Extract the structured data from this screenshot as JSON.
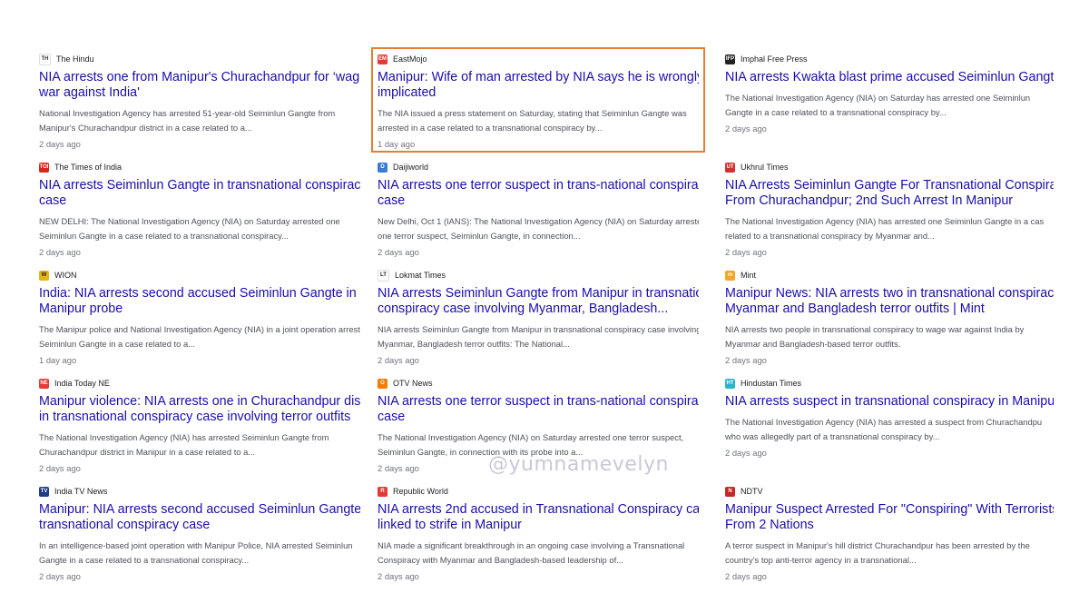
{
  "watermark": "@yumnamevelyn",
  "columns": [
    [
      {
        "source": "The Hindu",
        "favicon_text": "TH",
        "favicon_color": "#ffffff",
        "favicon_fg": "#333333",
        "title": [
          "NIA arrests one from Manipur's Churachandpur for ‘waging",
          "war against India'"
        ],
        "snippet": [
          "National Investigation Agency has arrested 51-year-old Seiminlun Gangte from",
          "Manipur's Churachandpur district in a case related to a..."
        ],
        "age": "2 days ago"
      },
      {
        "source": "The Times of India",
        "favicon_text": "TOI",
        "favicon_color": "#d7261e",
        "favicon_fg": "#ffffff",
        "title": [
          "NIA arrests Seiminlun Gangte in transnational conspiracy",
          "case"
        ],
        "snippet": [
          "NEW DELHI: The National Investigation Agency (NIA) on Saturday arrested one",
          "Seiminlun Gangte in a case related to a transnational conspiracy..."
        ],
        "age": "2 days ago"
      },
      {
        "source": "WION",
        "favicon_text": "W",
        "favicon_color": "#e7b416",
        "favicon_fg": "#222222",
        "title": [
          "India: NIA arrests second accused Seiminlun Gangte in",
          "Manipur probe"
        ],
        "snippet": [
          "The Manipur police and National Investigation Agency (NIA) in a joint operation arreste",
          "Seiminlun Gangte in a case related to a..."
        ],
        "age": "1 day ago"
      },
      {
        "source": "India Today NE",
        "favicon_text": "NE",
        "favicon_color": "#e53935",
        "favicon_fg": "#ffffff",
        "title": [
          "Manipur violence: NIA arrests one in Churachandpur district",
          "in transnational conspiracy case involving terror outfits"
        ],
        "snippet": [
          "The National Investigation Agency (NIA) has arrested Seiminlun Gangte from",
          "Churachandpur district in Manipur in a case related to a..."
        ],
        "age": "2 days ago"
      },
      {
        "source": "India TV News",
        "favicon_text": "TV",
        "favicon_color": "#1f3c88",
        "favicon_fg": "#ffffff",
        "title": [
          "Manipur: NIA arrests second accused Seiminlun Gangte in",
          "transnational conspiracy case"
        ],
        "snippet": [
          "In an intelligence-based joint operation with Manipur Police, NIA arrested Seiminlun",
          "Gangte in a case related to a transnational conspiracy..."
        ],
        "age": "2 days ago"
      }
    ],
    [
      {
        "source": "EastMojo",
        "favicon_text": "EM",
        "favicon_color": "#e53935",
        "favicon_fg": "#ffffff",
        "highlight": true,
        "title": [
          "Manipur: Wife of man arrested by NIA says he is wrongly",
          "implicated"
        ],
        "snippet": [
          "The NIA issued a press statement on Saturday, stating that Seiminlun Gangte was",
          "arrested in a case related to a transnational conspiracy by..."
        ],
        "age": "1 day ago"
      },
      {
        "source": "Daijiworld",
        "favicon_text": "D",
        "favicon_color": "#3a7bd5",
        "favicon_fg": "#ffffff",
        "title": [
          "NIA arrests one terror suspect in trans-national conspiracy",
          "case"
        ],
        "snippet": [
          "New Delhi, Oct 1 (IANS): The National Investigation Agency (NIA) on Saturday arrested",
          "one terror suspect, Seiminlun Gangte, in connection..."
        ],
        "age": "2 days ago"
      },
      {
        "source": "Lokmat Times",
        "favicon_text": "LT",
        "favicon_color": "#ffffff",
        "favicon_fg": "#222222",
        "title": [
          "NIA arrests Seiminlun Gangte from Manipur in transnational",
          "conspiracy case involving Myanmar, Bangladesh..."
        ],
        "snippet": [
          "NIA arrests Seiminlun Gangte from Manipur in transnational conspiracy case involving",
          "Myanmar, Bangladesh terror outfits: The National..."
        ],
        "age": "2 days ago"
      },
      {
        "source": "OTV News",
        "favicon_text": "O",
        "favicon_color": "#f57c00",
        "favicon_fg": "#ffffff",
        "title": [
          "NIA arrests one terror suspect in trans-national conspiracy",
          "case"
        ],
        "snippet": [
          "The National Investigation Agency (NIA) on Saturday arrested one terror suspect,",
          "Seiminlun Gangte, in connection with its probe into a..."
        ],
        "age": "2 days ago"
      },
      {
        "source": "Republic World",
        "favicon_text": "R",
        "favicon_color": "#e53935",
        "favicon_fg": "#ffffff",
        "title": [
          "NIA arrests 2nd accused in Transnational Conspiracy case",
          "linked to strife in Manipur"
        ],
        "snippet": [
          "NIA made a significant breakthrough in an ongoing case involving a Transnational",
          "Conspiracy with Myanmar and Bangladesh-based leadership of..."
        ],
        "age": "2 days ago"
      }
    ],
    [
      {
        "source": "Imphal Free Press",
        "favicon_text": "IFP",
        "favicon_color": "#222222",
        "favicon_fg": "#ffffff",
        "title": [
          "NIA arrests Kwakta blast prime accused Seiminlun Gangte"
        ],
        "snippet": [
          "The National Investigation Agency (NIA) on Saturday has arrested one Seiminlun",
          "Gangte in a case related to a transnational conspiracy by..."
        ],
        "age": "2 days ago"
      },
      {
        "source": "Ukhrul Times",
        "favicon_text": "UT",
        "favicon_color": "#d32f2f",
        "favicon_fg": "#ffffff",
        "title": [
          "NIA Arrests Seiminlun Gangte For Transnational Conspiracy",
          "From Churachandpur; 2nd Such Arrest In Manipur"
        ],
        "snippet": [
          "The National Investigation Agency (NIA) has arrested one Seiminlun Gangte in a cas",
          "related to a transnational conspiracy by Myanmar and..."
        ],
        "age": "2 days ago"
      },
      {
        "source": "Mint",
        "favicon_text": "m",
        "favicon_color": "#f5a623",
        "favicon_fg": "#ffffff",
        "title": [
          "Manipur News: NIA arrests two in transnational conspiracy",
          "Myanmar and Bangladesh terror outfits | Mint"
        ],
        "snippet": [
          "NIA arrests two people in transnational conspiracy to wage war against India by",
          "Myanmar and Bangladesh-based terror outfits."
        ],
        "age": "2 days ago"
      },
      {
        "source": "Hindustan Times",
        "favicon_text": "HT",
        "favicon_color": "#29b6c8",
        "favicon_fg": "#ffffff",
        "title": [
          "NIA arrests suspect in transnational conspiracy in Manipur"
        ],
        "snippet": [
          "The National Investigation Agency (NIA) has arrested a suspect from Churachandpu",
          "who was allegedly part of a transnational conspiracy by..."
        ],
        "age": "2 days ago"
      },
      {
        "source": "NDTV",
        "favicon_text": "N",
        "favicon_color": "#c62828",
        "favicon_fg": "#ffffff",
        "title": [
          "Manipur Suspect Arrested For \"Conspiring\" With Terrorists",
          "From 2 Nations"
        ],
        "snippet": [
          "A terror suspect in Manipur's hill district Churachandpur has been arrested by the",
          "country's top anti-terror agency in a transnational..."
        ],
        "age": "2 days ago"
      }
    ]
  ]
}
